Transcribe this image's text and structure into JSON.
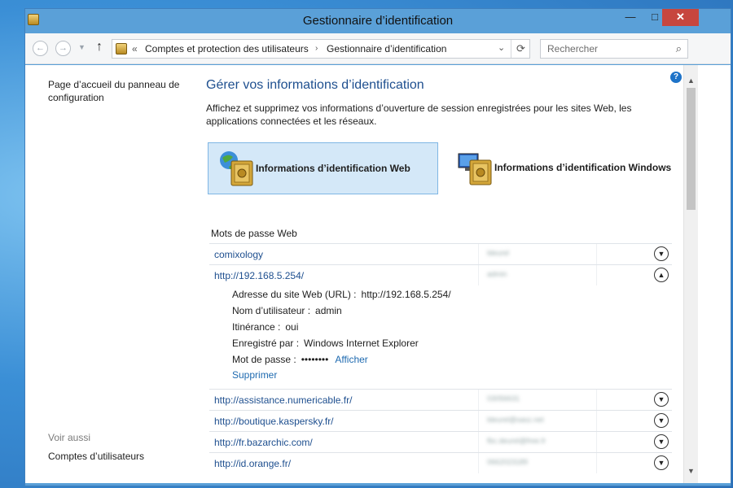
{
  "window": {
    "title": "Gestionnaire d’identification",
    "min_label": "—",
    "max_label": "□",
    "close_label": "✕"
  },
  "nav": {
    "back_glyph": "←",
    "fwd_glyph": "→",
    "up_glyph": "↑",
    "crumb_prefix": "«",
    "breadcrumbs": [
      "Comptes et protection des utilisateurs",
      "Gestionnaire d’identification"
    ],
    "crumb_sep": "›",
    "search_placeholder": "Rechercher"
  },
  "left": {
    "home_link": "Page d’accueil du panneau de configuration",
    "see_also": "Voir aussi",
    "accounts_link": "Comptes d’utilisateurs"
  },
  "main": {
    "heading": "Gérer vos informations d’identification",
    "description": "Affichez et supprimez vos informations d’ouverture de session enregistrées pour les sites Web, les applications connectées et les réseaux.",
    "tile_web": "Informations d’identification Web",
    "tile_windows": "Informations d’identification Windows",
    "section_title": "Mots de passe Web",
    "entries": [
      {
        "url": "comixology",
        "user": "ldeurel",
        "expanded": false
      },
      {
        "url": "http://192.168.5.254/",
        "user": "admin",
        "expanded": true
      },
      {
        "url": "http://assistance.numericable.fr/",
        "user": "03056631",
        "expanded": false
      },
      {
        "url": "http://boutique.kaspersky.fr/",
        "user": "ldeurel@sasz.net",
        "expanded": false
      },
      {
        "url": "http://fr.bazarchic.com/",
        "user": "fbc.deurel@free.fr",
        "expanded": false
      },
      {
        "url": "http://id.orange.fr/",
        "user": "0662023189",
        "expanded": false
      }
    ],
    "details": {
      "site_label": "Adresse du site Web (URL) :",
      "site_value": "http://192.168.5.254/",
      "user_label": "Nom d’utilisateur :",
      "user_value": "admin",
      "roaming_label": "Itinérance :",
      "roaming_value": "oui",
      "saved_label": "Enregistré par :",
      "saved_value": "Windows Internet Explorer",
      "pwd_label": "Mot de passe :",
      "pwd_value": "••••••••",
      "show_link": "Afficher",
      "delete_link": "Supprimer"
    }
  },
  "icons": {
    "expand": "chevron-down-icon",
    "collapse": "chevron-up-icon"
  },
  "colors": {
    "accent": "#1e4f8f",
    "link": "#1e6ab0",
    "tile_selected": "#d4e8f8",
    "titlebar": "#5aa0d8",
    "close": "#c7463e"
  }
}
